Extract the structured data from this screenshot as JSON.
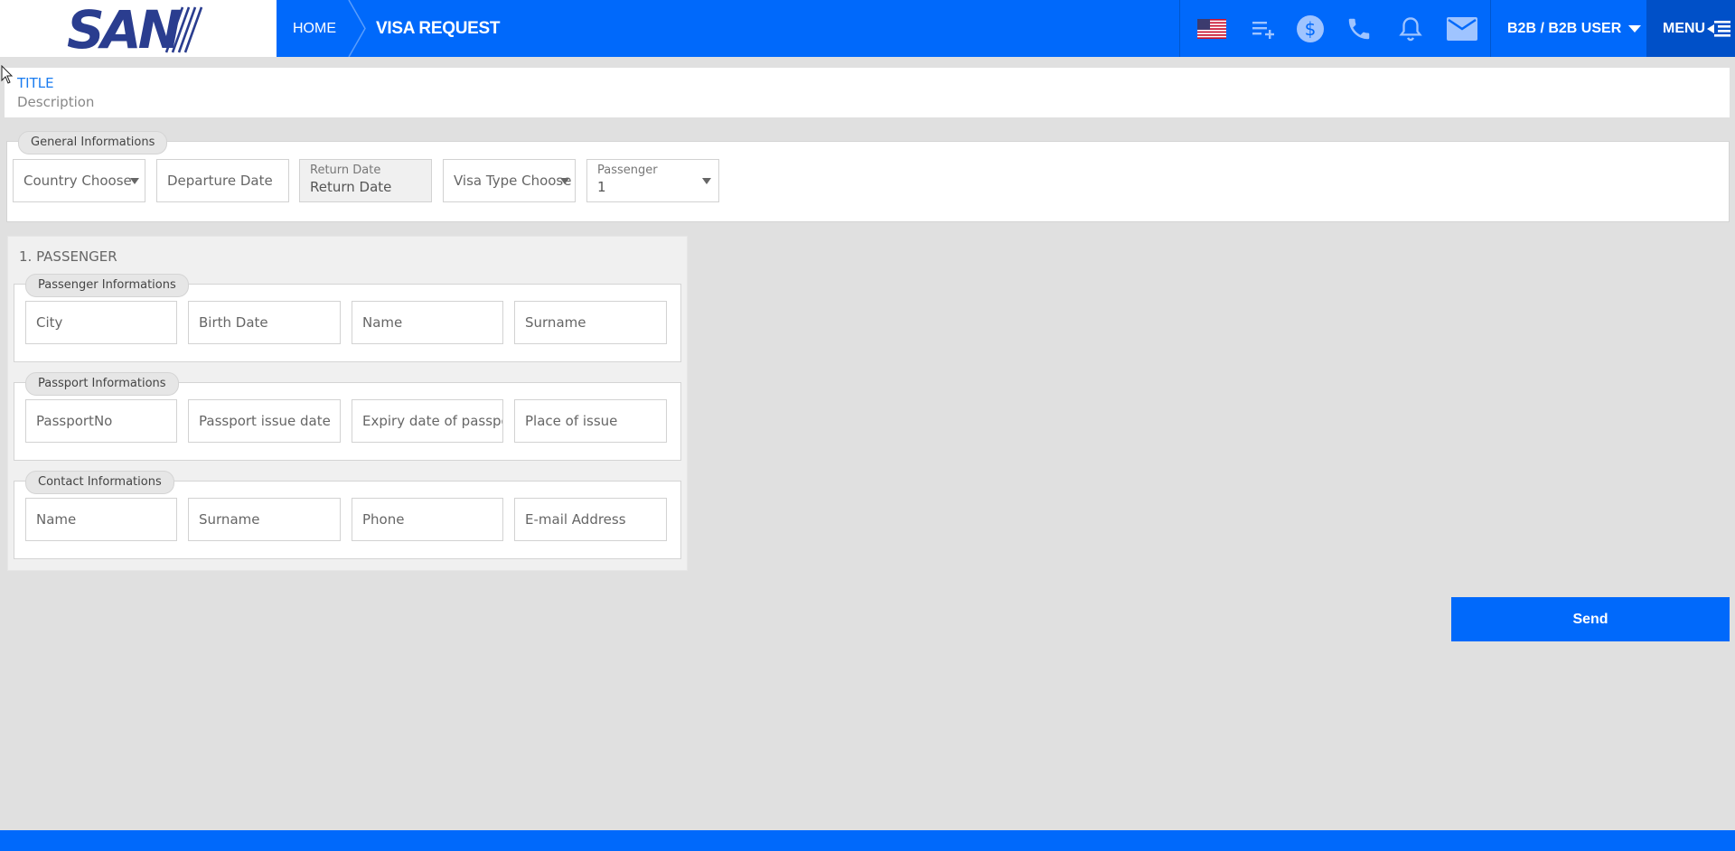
{
  "header": {
    "logo_text": "SAN",
    "breadcrumb": {
      "home": "HOME",
      "current": "VISA REQUEST"
    },
    "icons": [
      "us-flag-icon",
      "playlist-add-icon",
      "dollar-icon",
      "phone-icon",
      "bell-icon",
      "mail-icon"
    ],
    "user_label": "B2B / B2B USER",
    "menu_label": "MENU",
    "brand_color": "#0069fb"
  },
  "title_card": {
    "title": "TITLE",
    "description": "Description"
  },
  "general": {
    "legend": "General Informations",
    "country": "Country Choose",
    "departure_placeholder": "Departure Date",
    "return_label": "Return Date",
    "return_value": "Return Date",
    "visa_type": "Visa Type Choose",
    "passenger_label": "Passenger",
    "passenger_value": "1"
  },
  "passenger": {
    "heading": "1. PASSENGER",
    "info": {
      "legend": "Passenger Informations",
      "city": "City",
      "birth_date": "Birth Date",
      "name": "Name",
      "surname": "Surname"
    },
    "passport": {
      "legend": "Passport Informations",
      "passport_no": "PassportNo",
      "issue_date": "Passport issue date",
      "expiry_date": "Expiry date of passport",
      "place_of_issue": "Place of issue"
    },
    "contact": {
      "legend": "Contact Informations",
      "name": "Name",
      "surname": "Surname",
      "phone": "Phone",
      "email": "E-mail Address"
    }
  },
  "send_label": "Send"
}
